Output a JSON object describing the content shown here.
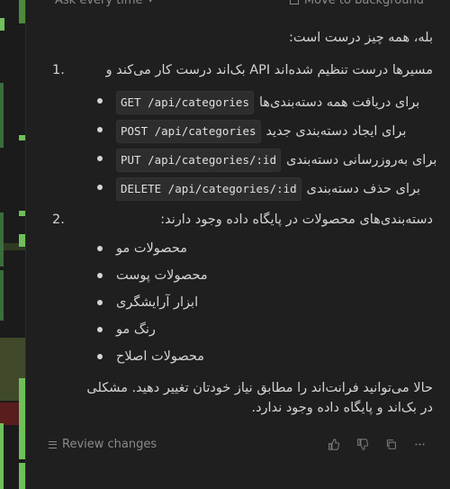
{
  "toolbar": {
    "mode_label": "Ask every time",
    "move_label": "Move to background"
  },
  "message": {
    "intro": "بله، همه چیز درست است:",
    "items": [
      {
        "number": "1.",
        "text": "مسیرها درست تنظیم شده‌اند API بک‌اند درست کار می‌کند و",
        "bullets": [
          {
            "code": "GET /api/categories",
            "text": "برای دریافت همه دسته‌بندی‌ها"
          },
          {
            "code": "POST /api/categories",
            "text": "برای ایجاد دسته‌بندی جدید"
          },
          {
            "code": "PUT /api/categories/:id",
            "text": "برای به‌روزرسانی دسته‌بندی"
          },
          {
            "code": "DELETE /api/categories/:id",
            "text": "برای حذف دسته‌بندی"
          }
        ]
      },
      {
        "number": "2.",
        "text": "دسته‌بندی‌های محصولات در پایگاه داده وجود دارند:",
        "bullets": [
          {
            "text": "محصولات مو"
          },
          {
            "text": "محصولات پوست"
          },
          {
            "text": "ابزار آرایشگری"
          },
          {
            "text": "رنگ مو"
          },
          {
            "text": "محصولات اصلاح"
          }
        ]
      }
    ],
    "outro_line1": "حالا می‌توانید فرانت‌اند را مطابق نیاز خودتان تغییر دهید. مشکلی",
    "outro_line2": "در بک‌اند و پایگاه داده وجود ندارد."
  },
  "footer": {
    "review_label": "Review changes",
    "icons": [
      "thumbs-up-icon",
      "thumbs-down-icon",
      "copy-icon",
      "more-icon"
    ]
  },
  "colors": {
    "background": "#1f1f1f",
    "text": "#d4d4d4",
    "muted": "#8a8a8a",
    "code_bg": "#2d2d2d",
    "gutter_green": "#4e5a34",
    "gutter_red": "#5a1d1d",
    "gutter_accent": "#6fbf5a"
  }
}
